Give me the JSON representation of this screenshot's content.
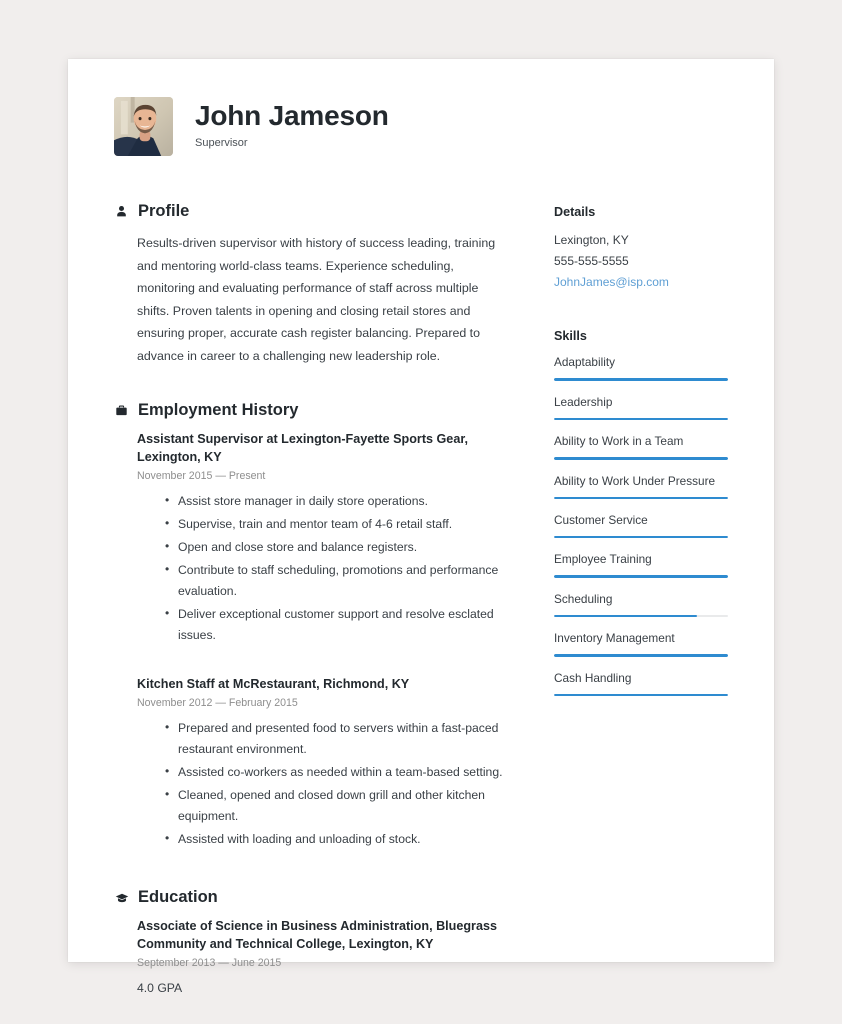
{
  "header": {
    "name": "John Jameson",
    "job_title": "Supervisor",
    "avatar_icon": "profile-photo"
  },
  "sections": {
    "profile": {
      "title": "Profile",
      "icon": "person-icon",
      "text": "Results-driven supervisor with history of success leading, training and mentoring world-class teams. Experience scheduling, monitoring and evaluating performance of staff across multiple shifts. Proven talents in opening and closing retail stores and ensuring proper, accurate cash register balancing. Prepared to advance in career to a challenging new leadership role."
    },
    "employment": {
      "title": "Employment History",
      "icon": "briefcase-icon",
      "entries": [
        {
          "title": "Assistant Supervisor at Lexington-Fayette Sports Gear, Lexington, KY",
          "date": "November 2015 — Present",
          "bullets": [
            "Assist store manager in daily store operations.",
            "Supervise, train and mentor team of 4-6 retail staff.",
            "Open and close  store and balance registers.",
            "Contribute to staff scheduling, promotions and performance evaluation.",
            "Deliver exceptional customer support and resolve esclated issues."
          ]
        },
        {
          "title": "Kitchen Staff at  McRestaurant, Richmond, KY",
          "date": "November 2012 — February 2015",
          "bullets": [
            "Prepared and presented food to servers within a fast-paced restaurant environment.",
            "Assisted co-workers as needed within a team-based setting.",
            "Cleaned, opened and closed down grill and other kitchen equipment.",
            "Assisted with loading and unloading of stock."
          ]
        }
      ]
    },
    "education": {
      "title": "Education",
      "icon": "graduation-cap-icon",
      "entries": [
        {
          "title": "Associate of Science in Business Administration, Bluegrass Community and Technical College, Lexington, KY",
          "date": "September 2013 — June 2015",
          "extra": "4.0 GPA"
        }
      ]
    }
  },
  "sidebar": {
    "details": {
      "title": "Details",
      "location": "Lexington, KY",
      "phone": "555-555-5555",
      "email": "JohnJames@isp.com"
    },
    "skills": {
      "title": "Skills",
      "items": [
        {
          "label": "Adaptability",
          "level": 100
        },
        {
          "label": "Leadership",
          "level": 100
        },
        {
          "label": "Ability to Work in a Team",
          "level": 100
        },
        {
          "label": "Ability to Work Under Pressure",
          "level": 100
        },
        {
          "label": "Customer Service",
          "level": 100
        },
        {
          "label": "Employee Training",
          "level": 100
        },
        {
          "label": "Scheduling",
          "level": 82
        },
        {
          "label": "Inventory Management",
          "level": 100
        },
        {
          "label": "Cash Handling",
          "level": 100
        }
      ]
    }
  },
  "colors": {
    "accent": "#2e8bd0",
    "link": "#5f9fd4",
    "text": "#3a4046",
    "heading": "#23292e",
    "muted": "#8e8e8e",
    "page_bg": "#f1eeed",
    "card_bg": "#ffffff"
  }
}
